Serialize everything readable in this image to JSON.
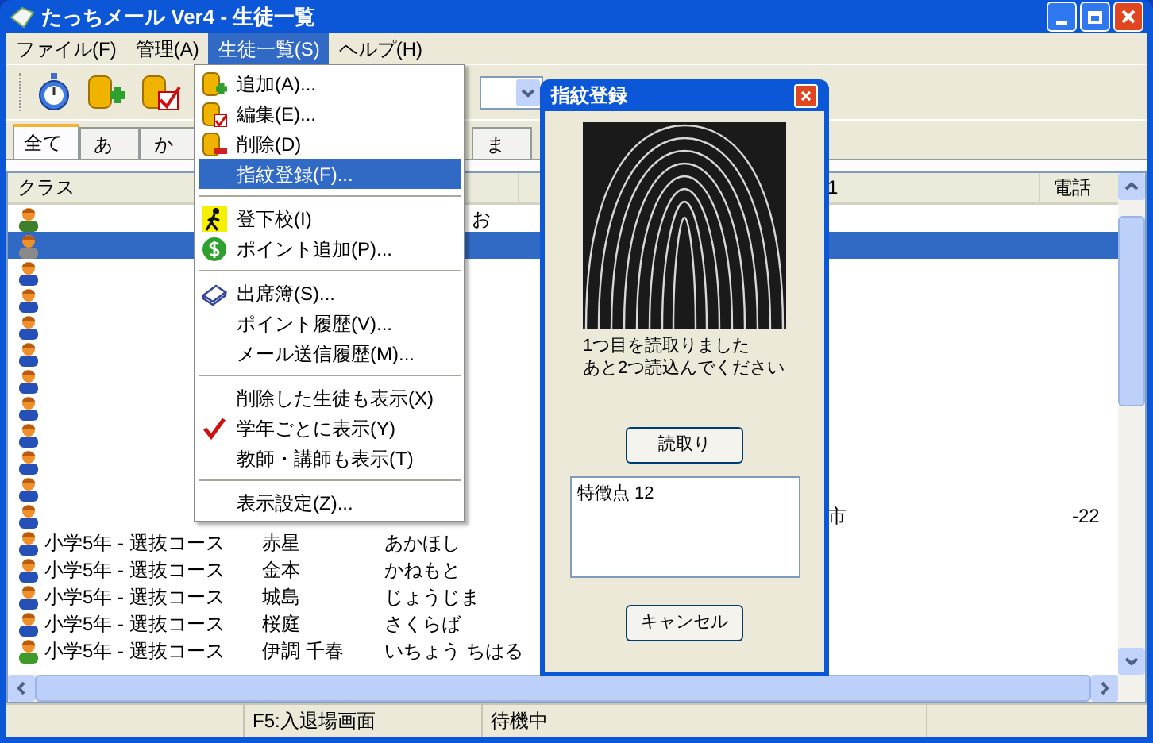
{
  "window": {
    "title": "たっちメール Ver4 - 生徒一覧"
  },
  "menu_bar": [
    {
      "label": "ファイル(F)",
      "selected": false
    },
    {
      "label": "管理(A)",
      "selected": false
    },
    {
      "label": "生徒一覧(S)",
      "selected": true
    },
    {
      "label": "ヘルプ(H)",
      "selected": false
    }
  ],
  "tabs": [
    {
      "label": "全て",
      "selected": true
    },
    {
      "label": "あ",
      "selected": false
    },
    {
      "label": "か",
      "selected": false
    },
    {
      "label": "ま",
      "selected": false
    }
  ],
  "table": {
    "columns": [
      "クラス",
      "1",
      "電話"
    ],
    "rows": [
      {
        "selected": false,
        "color": "#3f7f2a",
        "kana": "お"
      },
      {
        "selected": true,
        "color": "#8a8a8a"
      },
      {
        "selected": false,
        "color": "#2450b8"
      },
      {
        "selected": false,
        "color": "#2450b8"
      },
      {
        "selected": false,
        "color": "#2450b8"
      },
      {
        "selected": false,
        "color": "#2450b8"
      },
      {
        "selected": false,
        "color": "#2450b8"
      },
      {
        "selected": false,
        "color": "#2450b8"
      },
      {
        "selected": false,
        "color": "#2450b8"
      },
      {
        "selected": false,
        "color": "#2450b8"
      },
      {
        "selected": false,
        "color": "#2450b8"
      },
      {
        "selected": false,
        "color": "#2450b8",
        "address": "市",
        "phone": "-22"
      },
      {
        "selected": false,
        "color": "#2450b8",
        "class": "小学5年 - 選抜コース",
        "name": "赤星",
        "kana": "あかほし"
      },
      {
        "selected": false,
        "color": "#2450b8",
        "class": "小学5年 - 選抜コース",
        "name": "金本",
        "kana": "かねもと"
      },
      {
        "selected": false,
        "color": "#2450b8",
        "class": "小学5年 - 選抜コース",
        "name": "城島",
        "kana": "じょうじま"
      },
      {
        "selected": false,
        "color": "#2450b8",
        "class": "小学5年 - 選抜コース",
        "name": "桜庭",
        "kana": "さくらば"
      },
      {
        "selected": false,
        "color": "#3f9a2a",
        "class": "小学5年 - 選抜コース",
        "name": "伊調 千春",
        "kana": "いちょう ちはる"
      }
    ]
  },
  "context_menu": {
    "items": [
      {
        "kind": "db-add",
        "label": "追加(A)...",
        "selected": false
      },
      {
        "kind": "db-edit",
        "label": "編集(E)...",
        "selected": false
      },
      {
        "kind": "db-delete",
        "label": "削除(D)",
        "selected": false
      },
      {
        "kind": "plain",
        "label": "指紋登録(F)...",
        "selected": true,
        "checked": false
      },
      {
        "kind": "separator"
      },
      {
        "kind": "walker",
        "label": "登下校(I)",
        "selected": false
      },
      {
        "kind": "coin",
        "label": "ポイント追加(P)...",
        "selected": false
      },
      {
        "kind": "separator"
      },
      {
        "kind": "book",
        "label": "出席簿(S)...",
        "selected": false
      },
      {
        "kind": "plain",
        "label": "ポイント履歴(V)...",
        "selected": false,
        "checked": false
      },
      {
        "kind": "plain",
        "label": "メール送信履歴(M)...",
        "selected": false,
        "checked": false
      },
      {
        "kind": "separator"
      },
      {
        "kind": "plain",
        "label": "削除した生徒も表示(X)",
        "selected": false,
        "checked": false
      },
      {
        "kind": "plain",
        "label": "学年ごとに表示(Y)",
        "selected": false,
        "checked": true
      },
      {
        "kind": "plain",
        "label": "教師・講師も表示(T)",
        "selected": false,
        "checked": false
      },
      {
        "kind": "separator"
      },
      {
        "kind": "plain",
        "label": "表示設定(Z)...",
        "selected": false,
        "checked": false
      }
    ]
  },
  "dialog": {
    "title": "指紋登録",
    "message_lines": [
      "1つ目を読取りました",
      "あと2つ読込んでください"
    ],
    "read_button": "読取り",
    "result": "特徴点 12",
    "cancel_button": "キャンセル"
  },
  "status_bar": [
    "F5:入退場画面",
    "待機中"
  ]
}
